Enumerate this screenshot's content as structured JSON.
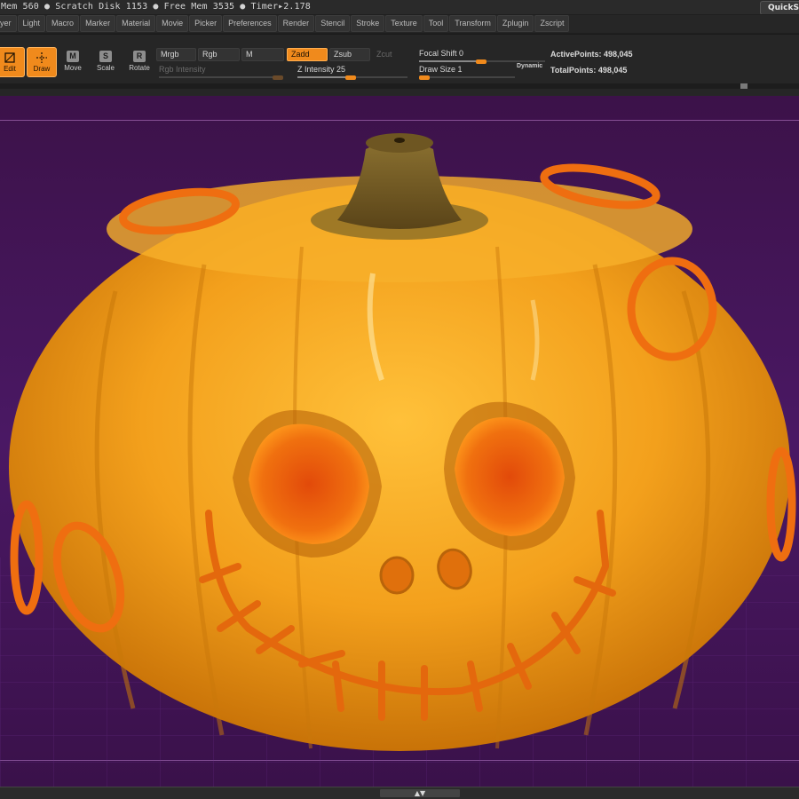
{
  "status": {
    "text": "Mem 560 ● Scratch Disk 1153 ● Free Mem 3535 ● Timer▸2.178",
    "quicksave": "QuickS"
  },
  "menu": [
    "ayer",
    "Light",
    "Macro",
    "Marker",
    "Material",
    "Movie",
    "Picker",
    "Preferences",
    "Render",
    "Stencil",
    "Stroke",
    "Texture",
    "Tool",
    "Transform",
    "Zplugin",
    "Zscript"
  ],
  "tools": {
    "edit": "Edit",
    "draw": "Draw",
    "move": "Move",
    "scale": "Scale",
    "rotate": "Rotate",
    "move_glyph": "M",
    "scale_glyph": "S",
    "rotate_glyph": "R"
  },
  "modes": {
    "mrgb": "Mrgb",
    "rgb": "Rgb",
    "m": "M",
    "zadd": "Zadd",
    "zsub": "Zsub",
    "zcut": "Zcut"
  },
  "sliders": {
    "rgb_intensity": "Rgb Intensity",
    "z_intensity": "Z Intensity 25",
    "focal_shift": "Focal Shift 0",
    "draw_size": "Draw Size 1",
    "dynamic": "Dynamic"
  },
  "stats": {
    "active_points": "ActivePoints: 498,045",
    "total_points": "TotalPoints: 498,045"
  },
  "bottom": {
    "arrows": "▲▼"
  },
  "colors": {
    "accent": "#f08a1c",
    "canvas_bg": "#441657",
    "pumpkin": "#f2a21c"
  }
}
